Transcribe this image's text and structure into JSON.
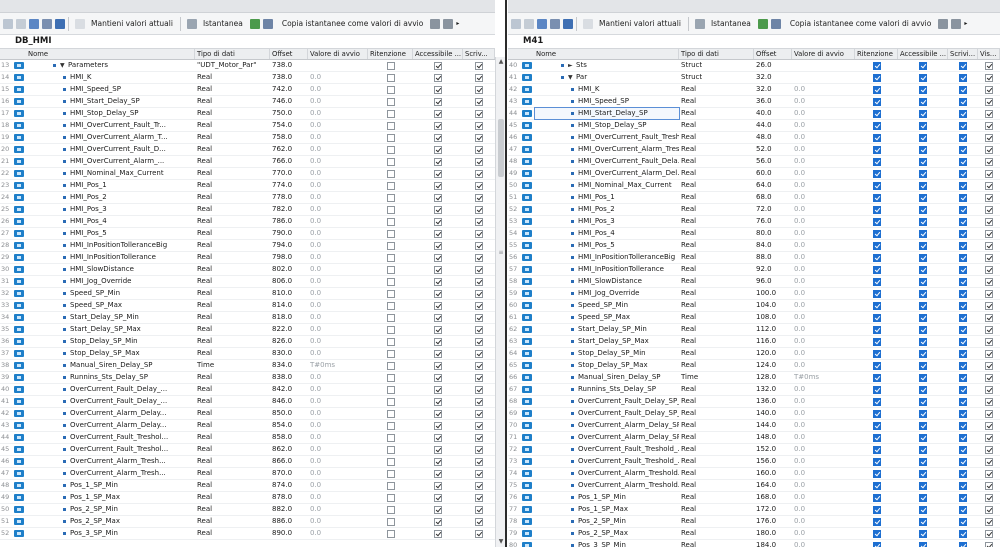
{
  "toolbar": {
    "keep_actual_values": "Mantieni valori attuali",
    "snapshot": "Istantanea",
    "copy_snapshots": "Copia istantanee come valori di avvio"
  },
  "left": {
    "block_name": "DB_HMI",
    "columns": [
      "Nome",
      "Tipo di dati",
      "Offset",
      "Valore di avvio",
      "Ritenzione",
      "Accessibile ...",
      "Scriv..."
    ],
    "rows": [
      {
        "n": "13",
        "name": "Parameters",
        "type": "\"UDT_Motor_Par\"",
        "offset": "738.0",
        "start": "",
        "ret": false,
        "acc": true,
        "wr": true,
        "level": 0,
        "expand": "▼"
      },
      {
        "n": "14",
        "name": "HMI_K",
        "type": "Real",
        "offset": "738.0",
        "start": "0.0",
        "ret": false,
        "acc": true,
        "wr": true,
        "level": 1
      },
      {
        "n": "15",
        "name": "HMI_Speed_SP",
        "type": "Real",
        "offset": "742.0",
        "start": "0.0",
        "ret": false,
        "acc": true,
        "wr": true,
        "level": 1
      },
      {
        "n": "16",
        "name": "HMI_Start_Delay_SP",
        "type": "Real",
        "offset": "746.0",
        "start": "0.0",
        "ret": false,
        "acc": true,
        "wr": true,
        "level": 1
      },
      {
        "n": "17",
        "name": "HMI_Stop_Delay_SP",
        "type": "Real",
        "offset": "750.0",
        "start": "0.0",
        "ret": false,
        "acc": true,
        "wr": true,
        "level": 1
      },
      {
        "n": "18",
        "name": "HMI_OverCurrent_Fault_Tr...",
        "type": "Real",
        "offset": "754.0",
        "start": "0.0",
        "ret": false,
        "acc": true,
        "wr": true,
        "level": 1
      },
      {
        "n": "19",
        "name": "HMI_OverCurrent_Alarm_T...",
        "type": "Real",
        "offset": "758.0",
        "start": "0.0",
        "ret": false,
        "acc": true,
        "wr": true,
        "level": 1
      },
      {
        "n": "20",
        "name": "HMI_OverCurrent_Fault_D...",
        "type": "Real",
        "offset": "762.0",
        "start": "0.0",
        "ret": false,
        "acc": true,
        "wr": true,
        "level": 1
      },
      {
        "n": "21",
        "name": "HMI_OverCurrent_Alarm_...",
        "type": "Real",
        "offset": "766.0",
        "start": "0.0",
        "ret": false,
        "acc": true,
        "wr": true,
        "level": 1
      },
      {
        "n": "22",
        "name": "HMI_Nominal_Max_Current",
        "type": "Real",
        "offset": "770.0",
        "start": "0.0",
        "ret": false,
        "acc": true,
        "wr": true,
        "level": 1
      },
      {
        "n": "23",
        "name": "HMI_Pos_1",
        "type": "Real",
        "offset": "774.0",
        "start": "0.0",
        "ret": false,
        "acc": true,
        "wr": true,
        "level": 1
      },
      {
        "n": "24",
        "name": "HMI_Pos_2",
        "type": "Real",
        "offset": "778.0",
        "start": "0.0",
        "ret": false,
        "acc": true,
        "wr": true,
        "level": 1
      },
      {
        "n": "25",
        "name": "HMI_Pos_3",
        "type": "Real",
        "offset": "782.0",
        "start": "0.0",
        "ret": false,
        "acc": true,
        "wr": true,
        "level": 1
      },
      {
        "n": "26",
        "name": "HMI_Pos_4",
        "type": "Real",
        "offset": "786.0",
        "start": "0.0",
        "ret": false,
        "acc": true,
        "wr": true,
        "level": 1
      },
      {
        "n": "27",
        "name": "HMI_Pos_5",
        "type": "Real",
        "offset": "790.0",
        "start": "0.0",
        "ret": false,
        "acc": true,
        "wr": true,
        "level": 1
      },
      {
        "n": "28",
        "name": "HMI_InPositionTolleranceBig",
        "type": "Real",
        "offset": "794.0",
        "start": "0.0",
        "ret": false,
        "acc": true,
        "wr": true,
        "level": 1
      },
      {
        "n": "29",
        "name": "HMI_InPositionTollerance",
        "type": "Real",
        "offset": "798.0",
        "start": "0.0",
        "ret": false,
        "acc": true,
        "wr": true,
        "level": 1
      },
      {
        "n": "30",
        "name": "HMI_SlowDistance",
        "type": "Real",
        "offset": "802.0",
        "start": "0.0",
        "ret": false,
        "acc": true,
        "wr": true,
        "level": 1
      },
      {
        "n": "31",
        "name": "HMI_Jog_Override",
        "type": "Real",
        "offset": "806.0",
        "start": "0.0",
        "ret": false,
        "acc": true,
        "wr": true,
        "level": 1
      },
      {
        "n": "32",
        "name": "Speed_SP_Min",
        "type": "Real",
        "offset": "810.0",
        "start": "0.0",
        "ret": false,
        "acc": true,
        "wr": true,
        "level": 1
      },
      {
        "n": "33",
        "name": "Speed_SP_Max",
        "type": "Real",
        "offset": "814.0",
        "start": "0.0",
        "ret": false,
        "acc": true,
        "wr": true,
        "level": 1
      },
      {
        "n": "34",
        "name": "Start_Delay_SP_Min",
        "type": "Real",
        "offset": "818.0",
        "start": "0.0",
        "ret": false,
        "acc": true,
        "wr": true,
        "level": 1
      },
      {
        "n": "35",
        "name": "Start_Delay_SP_Max",
        "type": "Real",
        "offset": "822.0",
        "start": "0.0",
        "ret": false,
        "acc": true,
        "wr": true,
        "level": 1
      },
      {
        "n": "36",
        "name": "Stop_Delay_SP_Min",
        "type": "Real",
        "offset": "826.0",
        "start": "0.0",
        "ret": false,
        "acc": true,
        "wr": true,
        "level": 1
      },
      {
        "n": "37",
        "name": "Stop_Delay_SP_Max",
        "type": "Real",
        "offset": "830.0",
        "start": "0.0",
        "ret": false,
        "acc": true,
        "wr": true,
        "level": 1
      },
      {
        "n": "38",
        "name": "Manual_Siren_Delay_SP",
        "type": "Time",
        "offset": "834.0",
        "start": "T#0ms",
        "ret": false,
        "acc": true,
        "wr": true,
        "level": 1
      },
      {
        "n": "39",
        "name": "Runnins_Sts_Delay_SP",
        "type": "Real",
        "offset": "838.0",
        "start": "0.0",
        "ret": false,
        "acc": true,
        "wr": true,
        "level": 1
      },
      {
        "n": "40",
        "name": "OverCurrent_Fault_Delay_...",
        "type": "Real",
        "offset": "842.0",
        "start": "0.0",
        "ret": false,
        "acc": true,
        "wr": true,
        "level": 1
      },
      {
        "n": "41",
        "name": "OverCurrent_Fault_Delay_...",
        "type": "Real",
        "offset": "846.0",
        "start": "0.0",
        "ret": false,
        "acc": true,
        "wr": true,
        "level": 1
      },
      {
        "n": "42",
        "name": "OverCurrent_Alarm_Delay...",
        "type": "Real",
        "offset": "850.0",
        "start": "0.0",
        "ret": false,
        "acc": true,
        "wr": true,
        "level": 1
      },
      {
        "n": "43",
        "name": "OverCurrent_Alarm_Delay...",
        "type": "Real",
        "offset": "854.0",
        "start": "0.0",
        "ret": false,
        "acc": true,
        "wr": true,
        "level": 1
      },
      {
        "n": "44",
        "name": "OverCurrent_Fault_Treshol...",
        "type": "Real",
        "offset": "858.0",
        "start": "0.0",
        "ret": false,
        "acc": true,
        "wr": true,
        "level": 1
      },
      {
        "n": "45",
        "name": "OverCurrent_Fault_Treshol...",
        "type": "Real",
        "offset": "862.0",
        "start": "0.0",
        "ret": false,
        "acc": true,
        "wr": true,
        "level": 1
      },
      {
        "n": "46",
        "name": "OverCurrent_Alarm_Tresh...",
        "type": "Real",
        "offset": "866.0",
        "start": "0.0",
        "ret": false,
        "acc": true,
        "wr": true,
        "level": 1
      },
      {
        "n": "47",
        "name": "OverCurrent_Alarm_Tresh...",
        "type": "Real",
        "offset": "870.0",
        "start": "0.0",
        "ret": false,
        "acc": true,
        "wr": true,
        "level": 1
      },
      {
        "n": "48",
        "name": "Pos_1_SP_Min",
        "type": "Real",
        "offset": "874.0",
        "start": "0.0",
        "ret": false,
        "acc": true,
        "wr": true,
        "level": 1
      },
      {
        "n": "49",
        "name": "Pos_1_SP_Max",
        "type": "Real",
        "offset": "878.0",
        "start": "0.0",
        "ret": false,
        "acc": true,
        "wr": true,
        "level": 1
      },
      {
        "n": "50",
        "name": "Pos_2_SP_Min",
        "type": "Real",
        "offset": "882.0",
        "start": "0.0",
        "ret": false,
        "acc": true,
        "wr": true,
        "level": 1
      },
      {
        "n": "51",
        "name": "Pos_2_SP_Max",
        "type": "Real",
        "offset": "886.0",
        "start": "0.0",
        "ret": false,
        "acc": true,
        "wr": true,
        "level": 1
      },
      {
        "n": "52",
        "name": "Pos_3_SP_Min",
        "type": "Real",
        "offset": "890.0",
        "start": "0.0",
        "ret": false,
        "acc": true,
        "wr": true,
        "level": 1
      }
    ]
  },
  "right": {
    "block_name": "M41",
    "columns": [
      "Nome",
      "Tipo di dati",
      "Offset",
      "Valore di avvio",
      "Ritenzione",
      "Accessibile ...",
      "Scrivi...",
      "Vis..."
    ],
    "rows": [
      {
        "n": "40",
        "name": "Sts",
        "type": "Struct",
        "offset": "26.0",
        "start": "",
        "ret": true,
        "acc": true,
        "wr": true,
        "level": 0,
        "expand": "►"
      },
      {
        "n": "41",
        "name": "Par",
        "type": "Struct",
        "offset": "32.0",
        "start": "",
        "ret": true,
        "acc": true,
        "wr": true,
        "level": 0,
        "expand": "▼"
      },
      {
        "n": "42",
        "name": "HMI_K",
        "type": "Real",
        "offset": "32.0",
        "start": "0.0",
        "ret": true,
        "acc": true,
        "wr": true,
        "level": 1
      },
      {
        "n": "43",
        "name": "HMI_Speed_SP",
        "type": "Real",
        "offset": "36.0",
        "start": "0.0",
        "ret": true,
        "acc": true,
        "wr": true,
        "level": 1
      },
      {
        "n": "44",
        "name": "HMI_Start_Delay_SP",
        "type": "Real",
        "offset": "40.0",
        "start": "0.0",
        "ret": true,
        "acc": true,
        "wr": true,
        "level": 1,
        "selected": true
      },
      {
        "n": "45",
        "name": "HMI_Stop_Delay_SP",
        "type": "Real",
        "offset": "44.0",
        "start": "0.0",
        "ret": true,
        "acc": true,
        "wr": true,
        "level": 1
      },
      {
        "n": "46",
        "name": "HMI_OverCurrent_Fault_Tresh...",
        "type": "Real",
        "offset": "48.0",
        "start": "0.0",
        "ret": true,
        "acc": true,
        "wr": true,
        "level": 1
      },
      {
        "n": "47",
        "name": "HMI_OverCurrent_Alarm_Tres...",
        "type": "Real",
        "offset": "52.0",
        "start": "0.0",
        "ret": true,
        "acc": true,
        "wr": true,
        "level": 1
      },
      {
        "n": "48",
        "name": "HMI_OverCurrent_Fault_Dela...",
        "type": "Real",
        "offset": "56.0",
        "start": "0.0",
        "ret": true,
        "acc": true,
        "wr": true,
        "level": 1
      },
      {
        "n": "49",
        "name": "HMI_OverCurrent_Alarm_Del...",
        "type": "Real",
        "offset": "60.0",
        "start": "0.0",
        "ret": true,
        "acc": true,
        "wr": true,
        "level": 1
      },
      {
        "n": "50",
        "name": "HMI_Nominal_Max_Current",
        "type": "Real",
        "offset": "64.0",
        "start": "0.0",
        "ret": true,
        "acc": true,
        "wr": true,
        "level": 1
      },
      {
        "n": "51",
        "name": "HMI_Pos_1",
        "type": "Real",
        "offset": "68.0",
        "start": "0.0",
        "ret": true,
        "acc": true,
        "wr": true,
        "level": 1
      },
      {
        "n": "52",
        "name": "HMI_Pos_2",
        "type": "Real",
        "offset": "72.0",
        "start": "0.0",
        "ret": true,
        "acc": true,
        "wr": true,
        "level": 1
      },
      {
        "n": "53",
        "name": "HMI_Pos_3",
        "type": "Real",
        "offset": "76.0",
        "start": "0.0",
        "ret": true,
        "acc": true,
        "wr": true,
        "level": 1
      },
      {
        "n": "54",
        "name": "HMI_Pos_4",
        "type": "Real",
        "offset": "80.0",
        "start": "0.0",
        "ret": true,
        "acc": true,
        "wr": true,
        "level": 1
      },
      {
        "n": "55",
        "name": "HMI_Pos_5",
        "type": "Real",
        "offset": "84.0",
        "start": "0.0",
        "ret": true,
        "acc": true,
        "wr": true,
        "level": 1
      },
      {
        "n": "56",
        "name": "HMI_InPositionTolleranceBig",
        "type": "Real",
        "offset": "88.0",
        "start": "0.0",
        "ret": true,
        "acc": true,
        "wr": true,
        "level": 1
      },
      {
        "n": "57",
        "name": "HMI_InPositionTollerance",
        "type": "Real",
        "offset": "92.0",
        "start": "0.0",
        "ret": true,
        "acc": true,
        "wr": true,
        "level": 1
      },
      {
        "n": "58",
        "name": "HMI_SlowDistance",
        "type": "Real",
        "offset": "96.0",
        "start": "0.0",
        "ret": true,
        "acc": true,
        "wr": true,
        "level": 1
      },
      {
        "n": "59",
        "name": "HMI_Jog_Override",
        "type": "Real",
        "offset": "100.0",
        "start": "0.0",
        "ret": true,
        "acc": true,
        "wr": true,
        "level": 1
      },
      {
        "n": "60",
        "name": "Speed_SP_Min",
        "type": "Real",
        "offset": "104.0",
        "start": "0.0",
        "ret": true,
        "acc": true,
        "wr": true,
        "level": 1
      },
      {
        "n": "61",
        "name": "Speed_SP_Max",
        "type": "Real",
        "offset": "108.0",
        "start": "0.0",
        "ret": true,
        "acc": true,
        "wr": true,
        "level": 1
      },
      {
        "n": "62",
        "name": "Start_Delay_SP_Min",
        "type": "Real",
        "offset": "112.0",
        "start": "0.0",
        "ret": true,
        "acc": true,
        "wr": true,
        "level": 1
      },
      {
        "n": "63",
        "name": "Start_Delay_SP_Max",
        "type": "Real",
        "offset": "116.0",
        "start": "0.0",
        "ret": true,
        "acc": true,
        "wr": true,
        "level": 1
      },
      {
        "n": "64",
        "name": "Stop_Delay_SP_Min",
        "type": "Real",
        "offset": "120.0",
        "start": "0.0",
        "ret": true,
        "acc": true,
        "wr": true,
        "level": 1
      },
      {
        "n": "65",
        "name": "Stop_Delay_SP_Max",
        "type": "Real",
        "offset": "124.0",
        "start": "0.0",
        "ret": true,
        "acc": true,
        "wr": true,
        "level": 1
      },
      {
        "n": "66",
        "name": "Manual_Siren_Delay_SP",
        "type": "Time",
        "offset": "128.0",
        "start": "T#0ms",
        "ret": true,
        "acc": true,
        "wr": true,
        "level": 1
      },
      {
        "n": "67",
        "name": "Runnins_Sts_Delay_SP",
        "type": "Real",
        "offset": "132.0",
        "start": "0.0",
        "ret": true,
        "acc": true,
        "wr": true,
        "level": 1
      },
      {
        "n": "68",
        "name": "OverCurrent_Fault_Delay_SP_...",
        "type": "Real",
        "offset": "136.0",
        "start": "0.0",
        "ret": true,
        "acc": true,
        "wr": true,
        "level": 1
      },
      {
        "n": "69",
        "name": "OverCurrent_Fault_Delay_SP_...",
        "type": "Real",
        "offset": "140.0",
        "start": "0.0",
        "ret": true,
        "acc": true,
        "wr": true,
        "level": 1
      },
      {
        "n": "70",
        "name": "OverCurrent_Alarm_Delay_SP...",
        "type": "Real",
        "offset": "144.0",
        "start": "0.0",
        "ret": true,
        "acc": true,
        "wr": true,
        "level": 1
      },
      {
        "n": "71",
        "name": "OverCurrent_Alarm_Delay_SP...",
        "type": "Real",
        "offset": "148.0",
        "start": "0.0",
        "ret": true,
        "acc": true,
        "wr": true,
        "level": 1
      },
      {
        "n": "72",
        "name": "OverCurrent_Fault_Treshold_...",
        "type": "Real",
        "offset": "152.0",
        "start": "0.0",
        "ret": true,
        "acc": true,
        "wr": true,
        "level": 1
      },
      {
        "n": "73",
        "name": "OverCurrent_Fault_Treshold_...",
        "type": "Real",
        "offset": "156.0",
        "start": "0.0",
        "ret": true,
        "acc": true,
        "wr": true,
        "level": 1
      },
      {
        "n": "74",
        "name": "OverCurrent_Alarm_Treshold...",
        "type": "Real",
        "offset": "160.0",
        "start": "0.0",
        "ret": true,
        "acc": true,
        "wr": true,
        "level": 1
      },
      {
        "n": "75",
        "name": "OverCurrent_Alarm_Treshold...",
        "type": "Real",
        "offset": "164.0",
        "start": "0.0",
        "ret": true,
        "acc": true,
        "wr": true,
        "level": 1
      },
      {
        "n": "76",
        "name": "Pos_1_SP_Min",
        "type": "Real",
        "offset": "168.0",
        "start": "0.0",
        "ret": true,
        "acc": true,
        "wr": true,
        "level": 1
      },
      {
        "n": "77",
        "name": "Pos_1_SP_Max",
        "type": "Real",
        "offset": "172.0",
        "start": "0.0",
        "ret": true,
        "acc": true,
        "wr": true,
        "level": 1
      },
      {
        "n": "78",
        "name": "Pos_2_SP_Min",
        "type": "Real",
        "offset": "176.0",
        "start": "0.0",
        "ret": true,
        "acc": true,
        "wr": true,
        "level": 1
      },
      {
        "n": "79",
        "name": "Pos_2_SP_Max",
        "type": "Real",
        "offset": "180.0",
        "start": "0.0",
        "ret": true,
        "acc": true,
        "wr": true,
        "level": 1
      },
      {
        "n": "80",
        "name": "Pos_3_SP_Min",
        "type": "Real",
        "offset": "184.0",
        "start": "0.0",
        "ret": true,
        "acc": true,
        "wr": true,
        "level": 1
      }
    ]
  },
  "colors": {
    "accent": "#1d6fd1",
    "io_icon": "#1e7fc9",
    "divider": "#2b2b2b"
  }
}
